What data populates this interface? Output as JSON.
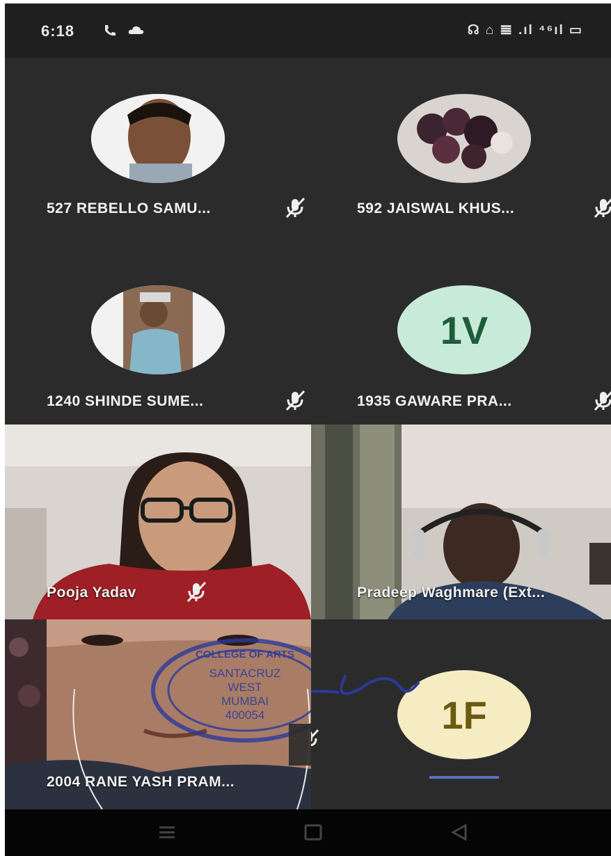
{
  "status_bar": {
    "time": "6:18",
    "left_icons": [
      "phone-call-icon",
      "cloud-icon"
    ],
    "right_text": "☊ ⌂ 𝌆 .ıl ⁴⁶ıl ▭",
    "right_icons": [
      "headset-icon",
      "wifi-icon",
      "signal-icon",
      "signal-icon",
      "4g-signal-icon",
      "battery-icon"
    ]
  },
  "participants": [
    {
      "name": "527 REBELLO SAMU...",
      "muted": true,
      "type": "photo"
    },
    {
      "name": "592 JAISWAL KHUS...",
      "muted": true,
      "type": "photo"
    },
    {
      "name": "1240 SHINDE SUME...",
      "muted": true,
      "type": "photo"
    },
    {
      "name": "1935 GAWARE PRA...",
      "muted": true,
      "type": "initials",
      "initials": "1V"
    },
    {
      "name": "Pooja Yadav",
      "muted": true,
      "type": "video"
    },
    {
      "name": "Pradeep Waghmare (Ext...",
      "muted": false,
      "type": "video"
    },
    {
      "name": "2004 RANE YASH PRAM...",
      "muted": true,
      "type": "video"
    },
    {
      "name": "",
      "muted": false,
      "type": "initials",
      "initials": "1F"
    }
  ],
  "stamp": {
    "lines": [
      "COLLEGE OF ARTS",
      "SANTACRUZ",
      "WEST",
      "MUMBAI",
      "400054"
    ]
  },
  "colors": {
    "tile_bg": "#2b2b2b",
    "avatar_1v": "#c8ebd9",
    "avatar_1v_text": "#1e5c3a",
    "avatar_1f": "#f6ecc4",
    "avatar_1f_text": "#6b5a10",
    "stamp": "#2a3a9c"
  },
  "nav_icons": [
    "menu-icon",
    "home-square-icon",
    "back-triangle-icon"
  ]
}
